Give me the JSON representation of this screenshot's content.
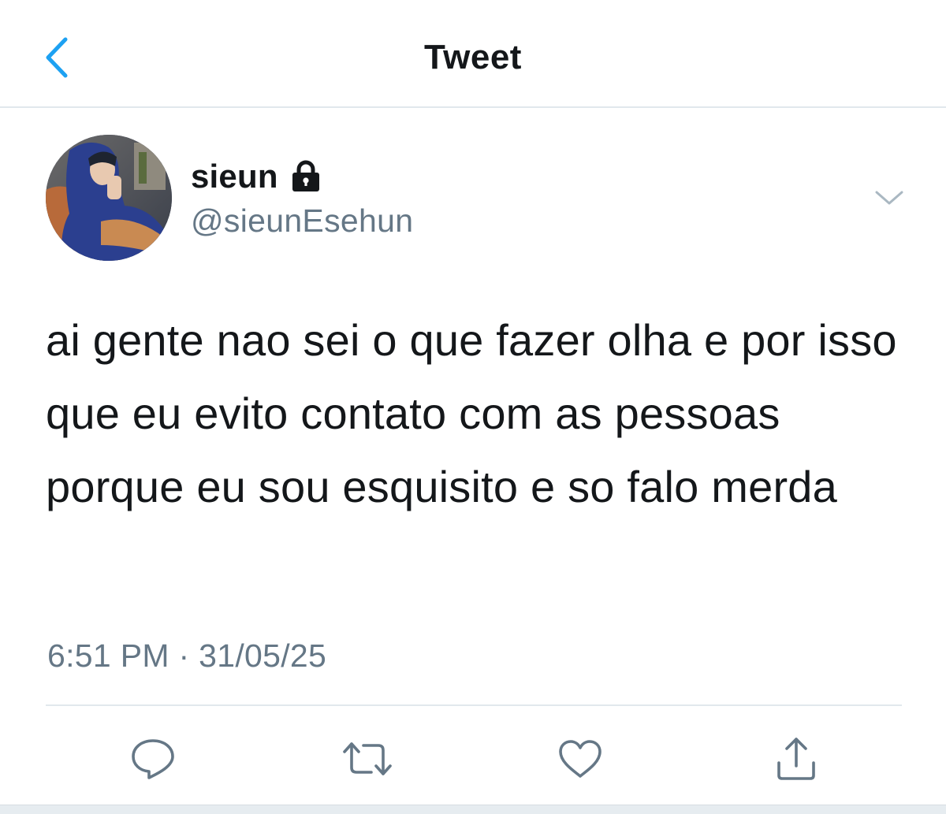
{
  "header": {
    "title": "Tweet",
    "back_icon": "chevron-left-icon"
  },
  "tweet": {
    "display_name": "sieun",
    "protected_icon": "lock-icon",
    "handle": "@sieunEsehun",
    "text": "ai gente nao sei o que fazer olha e por isso que eu evito contato com as pessoas porque eu sou esquisito e so falo merda",
    "timestamp": "6:51 PM · 31/05/25",
    "menu_icon": "chevron-down-icon"
  },
  "actions": [
    {
      "name": "reply",
      "icon": "reply-icon"
    },
    {
      "name": "retweet",
      "icon": "retweet-icon"
    },
    {
      "name": "like",
      "icon": "heart-icon"
    },
    {
      "name": "share",
      "icon": "share-icon"
    }
  ],
  "colors": {
    "accent": "#1da1f2",
    "text_primary": "#14171a",
    "text_secondary": "#657786",
    "divider": "#e1e8ed"
  }
}
